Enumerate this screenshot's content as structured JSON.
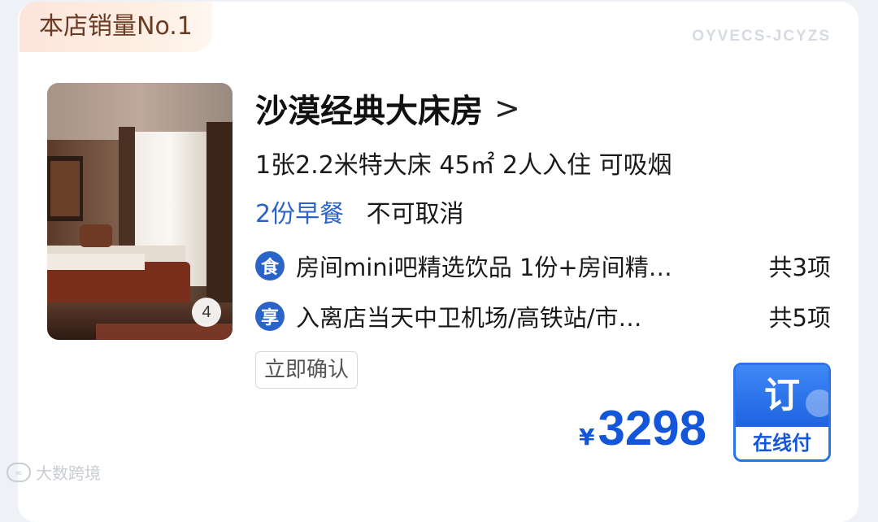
{
  "ribbon": "本店销量No.1",
  "code": "OYVECS-JCYZS",
  "room": {
    "title": "沙漠经典大床房",
    "chevron": ">",
    "specs": "1张2.2米特大床  45㎡  2人入住  可吸烟",
    "breakfast": "2份早餐",
    "cancel_policy": "不可取消",
    "photo_count": "4"
  },
  "perks": [
    {
      "icon": "食",
      "icon_name": "food-icon",
      "text": "房间mini吧精选饮品 1份+房间精…",
      "count": "共3项"
    },
    {
      "icon": "享",
      "icon_name": "enjoy-icon",
      "text": "入离店当天中卫机场/高铁站/市…",
      "count": "共5项"
    }
  ],
  "confirm_tag": "立即确认",
  "price": {
    "currency": "¥",
    "amount": "3298"
  },
  "book": {
    "top": "订",
    "bottom": "在线付"
  },
  "watermark": "大数跨境",
  "colors": {
    "accent": "#2a64c8",
    "price": "#1456d9",
    "ribbon_bg": "#fde5dc",
    "ribbon_text": "#6b3a22"
  }
}
